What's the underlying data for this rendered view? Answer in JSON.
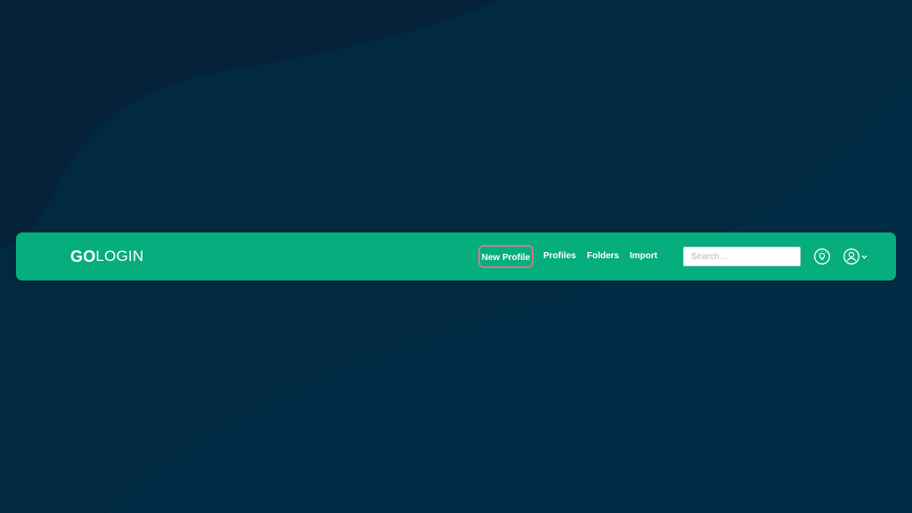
{
  "colors": {
    "background": "#012a40",
    "background_dark": "#05223a",
    "navbar": "#06ae7d",
    "text": "#ffffff",
    "highlight_border": "#c77f85"
  },
  "brand": {
    "logo_bold": "GO",
    "logo_light": "LOGIN"
  },
  "nav": {
    "new_profile": "New Profile",
    "profiles": "Profiles",
    "folders": "Folders",
    "import": "Import"
  },
  "search": {
    "placeholder": "Search...",
    "value": ""
  },
  "icons": {
    "tips": "lightbulb-icon",
    "account": "user-circle-icon",
    "account_menu": "chevron-down-icon"
  }
}
